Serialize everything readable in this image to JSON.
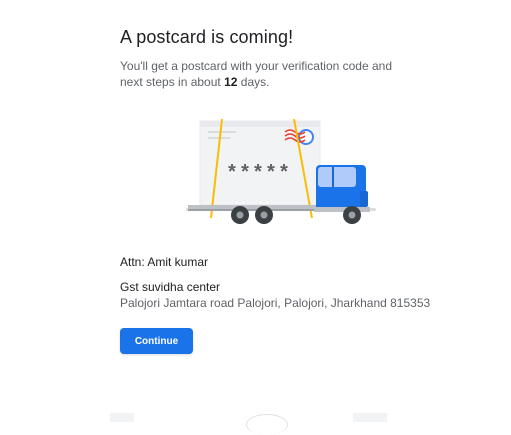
{
  "header": {
    "title": "A postcard is coming!",
    "description_before": "You'll get a postcard with your verification code and next steps in about ",
    "days": "12",
    "description_after": " days."
  },
  "illustration": {
    "code_mask": "*****",
    "truck_color": "#1a73e8",
    "strap_color": "#fbbc04"
  },
  "address": {
    "attn": "Attn: Amit kumar",
    "business_name": "Gst suvidha center",
    "street": "Palojori Jamtara road Palojori, Palojori, Jharkhand 815353"
  },
  "actions": {
    "continue_label": "Continue"
  }
}
